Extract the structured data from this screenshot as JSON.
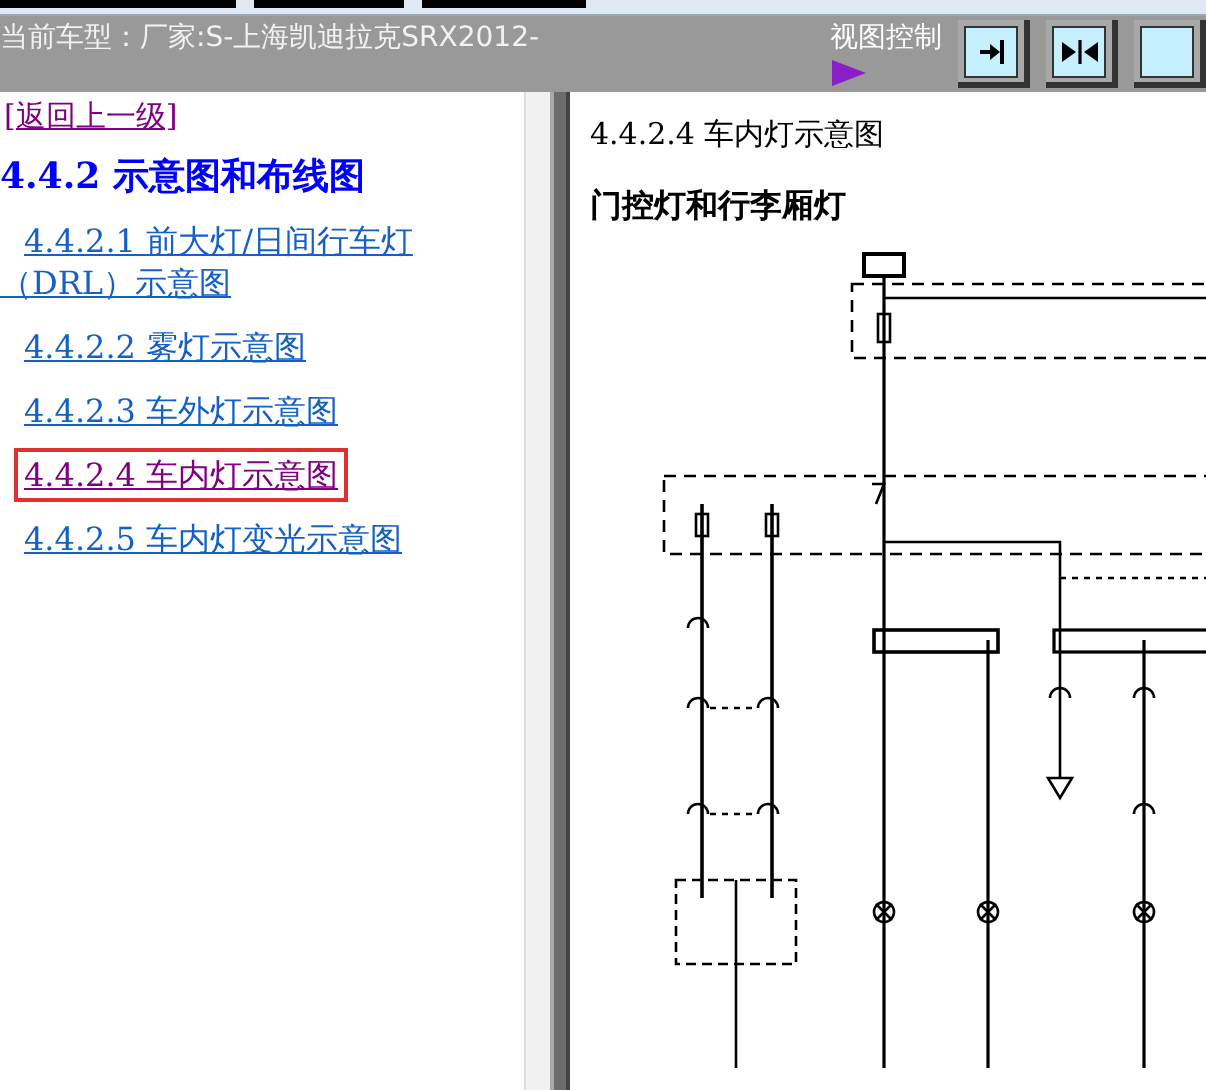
{
  "header": {
    "vehicle": "当前车型：厂家:S-上海凯迪拉克SRX2012-",
    "view_control": "视图控制"
  },
  "view_buttons": [
    {
      "kind": "dock-right"
    },
    {
      "kind": "split"
    },
    {
      "kind": "partial"
    }
  ],
  "nav": {
    "back_link": "[返回上一级]",
    "heading": "4.4.2 示意图和布线图",
    "items": [
      {
        "label": "4.4.2.1 前大灯/日间行车灯（DRL）示意图",
        "selected": false
      },
      {
        "label": "4.4.2.2 雾灯示意图",
        "selected": false
      },
      {
        "label": "4.4.2.3 车外灯示意图",
        "selected": false
      },
      {
        "label": "4.4.2.4 车内灯示意图",
        "selected": true
      },
      {
        "label": "4.4.2.5 车内灯变光示意图",
        "selected": false
      }
    ]
  },
  "document": {
    "title": "4.4.2.4 车内灯示意图",
    "subtitle": "门控灯和行李厢灯"
  }
}
